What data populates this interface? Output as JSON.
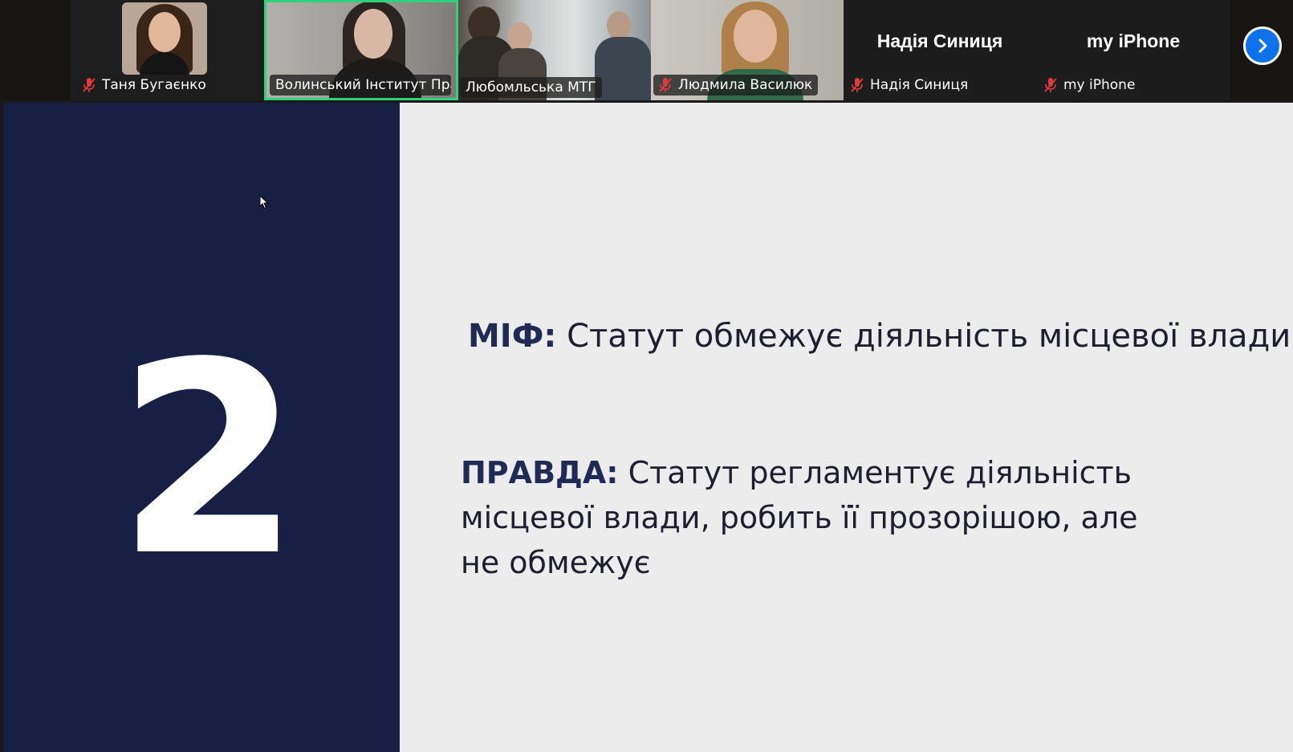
{
  "participants": [
    {
      "name": "Таня Бугаєнко",
      "muted": true,
      "video": true
    },
    {
      "name": "Волинський Інститут Пра...",
      "muted": false,
      "video": true,
      "active_speaker": true
    },
    {
      "name": "Любомльська МТГ",
      "muted": false,
      "video": true
    },
    {
      "name": "Людмила Василюк",
      "muted": true,
      "video": true
    },
    {
      "name": "Надія Синиця",
      "muted": true,
      "video": false,
      "display_name": "Надія Синиця"
    },
    {
      "name": "my iPhone",
      "muted": true,
      "video": false,
      "display_name": "my iPhone"
    }
  ],
  "icons": {
    "muted": "mic-muted-icon",
    "next": "chevron-right-icon",
    "cursor": "mouse-cursor-icon"
  },
  "colors": {
    "active_border": "#2fd27a",
    "slide_left_bg": "#172044",
    "slide_right_bg": "#ececec",
    "keyword": "#1f2a55",
    "next_button": "#0e72ed"
  },
  "slide": {
    "number": "2",
    "myth_label": "МІФ:",
    "myth_text": " Статут обмежує діяльність місцевої влади",
    "truth_label": "ПРАВДА:",
    "truth_text": " Статут регламентує діяльність місцевої влади, робить її прозорішою, але не обмежує"
  }
}
